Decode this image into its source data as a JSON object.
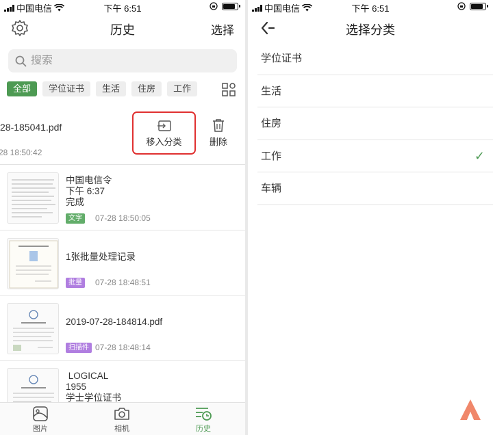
{
  "status": {
    "carrier": "中国电信",
    "time": "下午 6:51"
  },
  "left": {
    "nav": {
      "title": "历史",
      "select_label": "选择"
    },
    "search": {
      "placeholder": "搜索"
    },
    "chips": [
      "全部",
      "学位证书",
      "生活",
      "住房",
      "工作"
    ],
    "swiped": {
      "name": "28-185041.pdf",
      "date": "-28 18:50:42",
      "move_label": "移入分类",
      "delete_label": "删除"
    },
    "items": [
      {
        "title": "中国电信令\n下午 6:37\n完成",
        "tag": "文字",
        "time": "07-28 18:50:05"
      },
      {
        "title": "1张批量处理记录",
        "tag": "批量",
        "time": "07-28 18:48:51"
      },
      {
        "title": "2019-07-28-184814.pdf",
        "tag": "扫描件",
        "time": "07-28 18:48:14"
      },
      {
        "title": " LOGICAL\n1955\n学士学位证书"
      }
    ],
    "tabs": [
      "图片",
      "相机",
      "历史"
    ]
  },
  "right": {
    "nav": {
      "title": "选择分类"
    },
    "categories": [
      "学位证书",
      "生活",
      "住房",
      "工作",
      "车辆"
    ],
    "selected_check": "✓"
  },
  "colors": {
    "accent": "#4d9a53",
    "highlight_border": "#e03030",
    "tag_purple": "#b07ee0"
  }
}
